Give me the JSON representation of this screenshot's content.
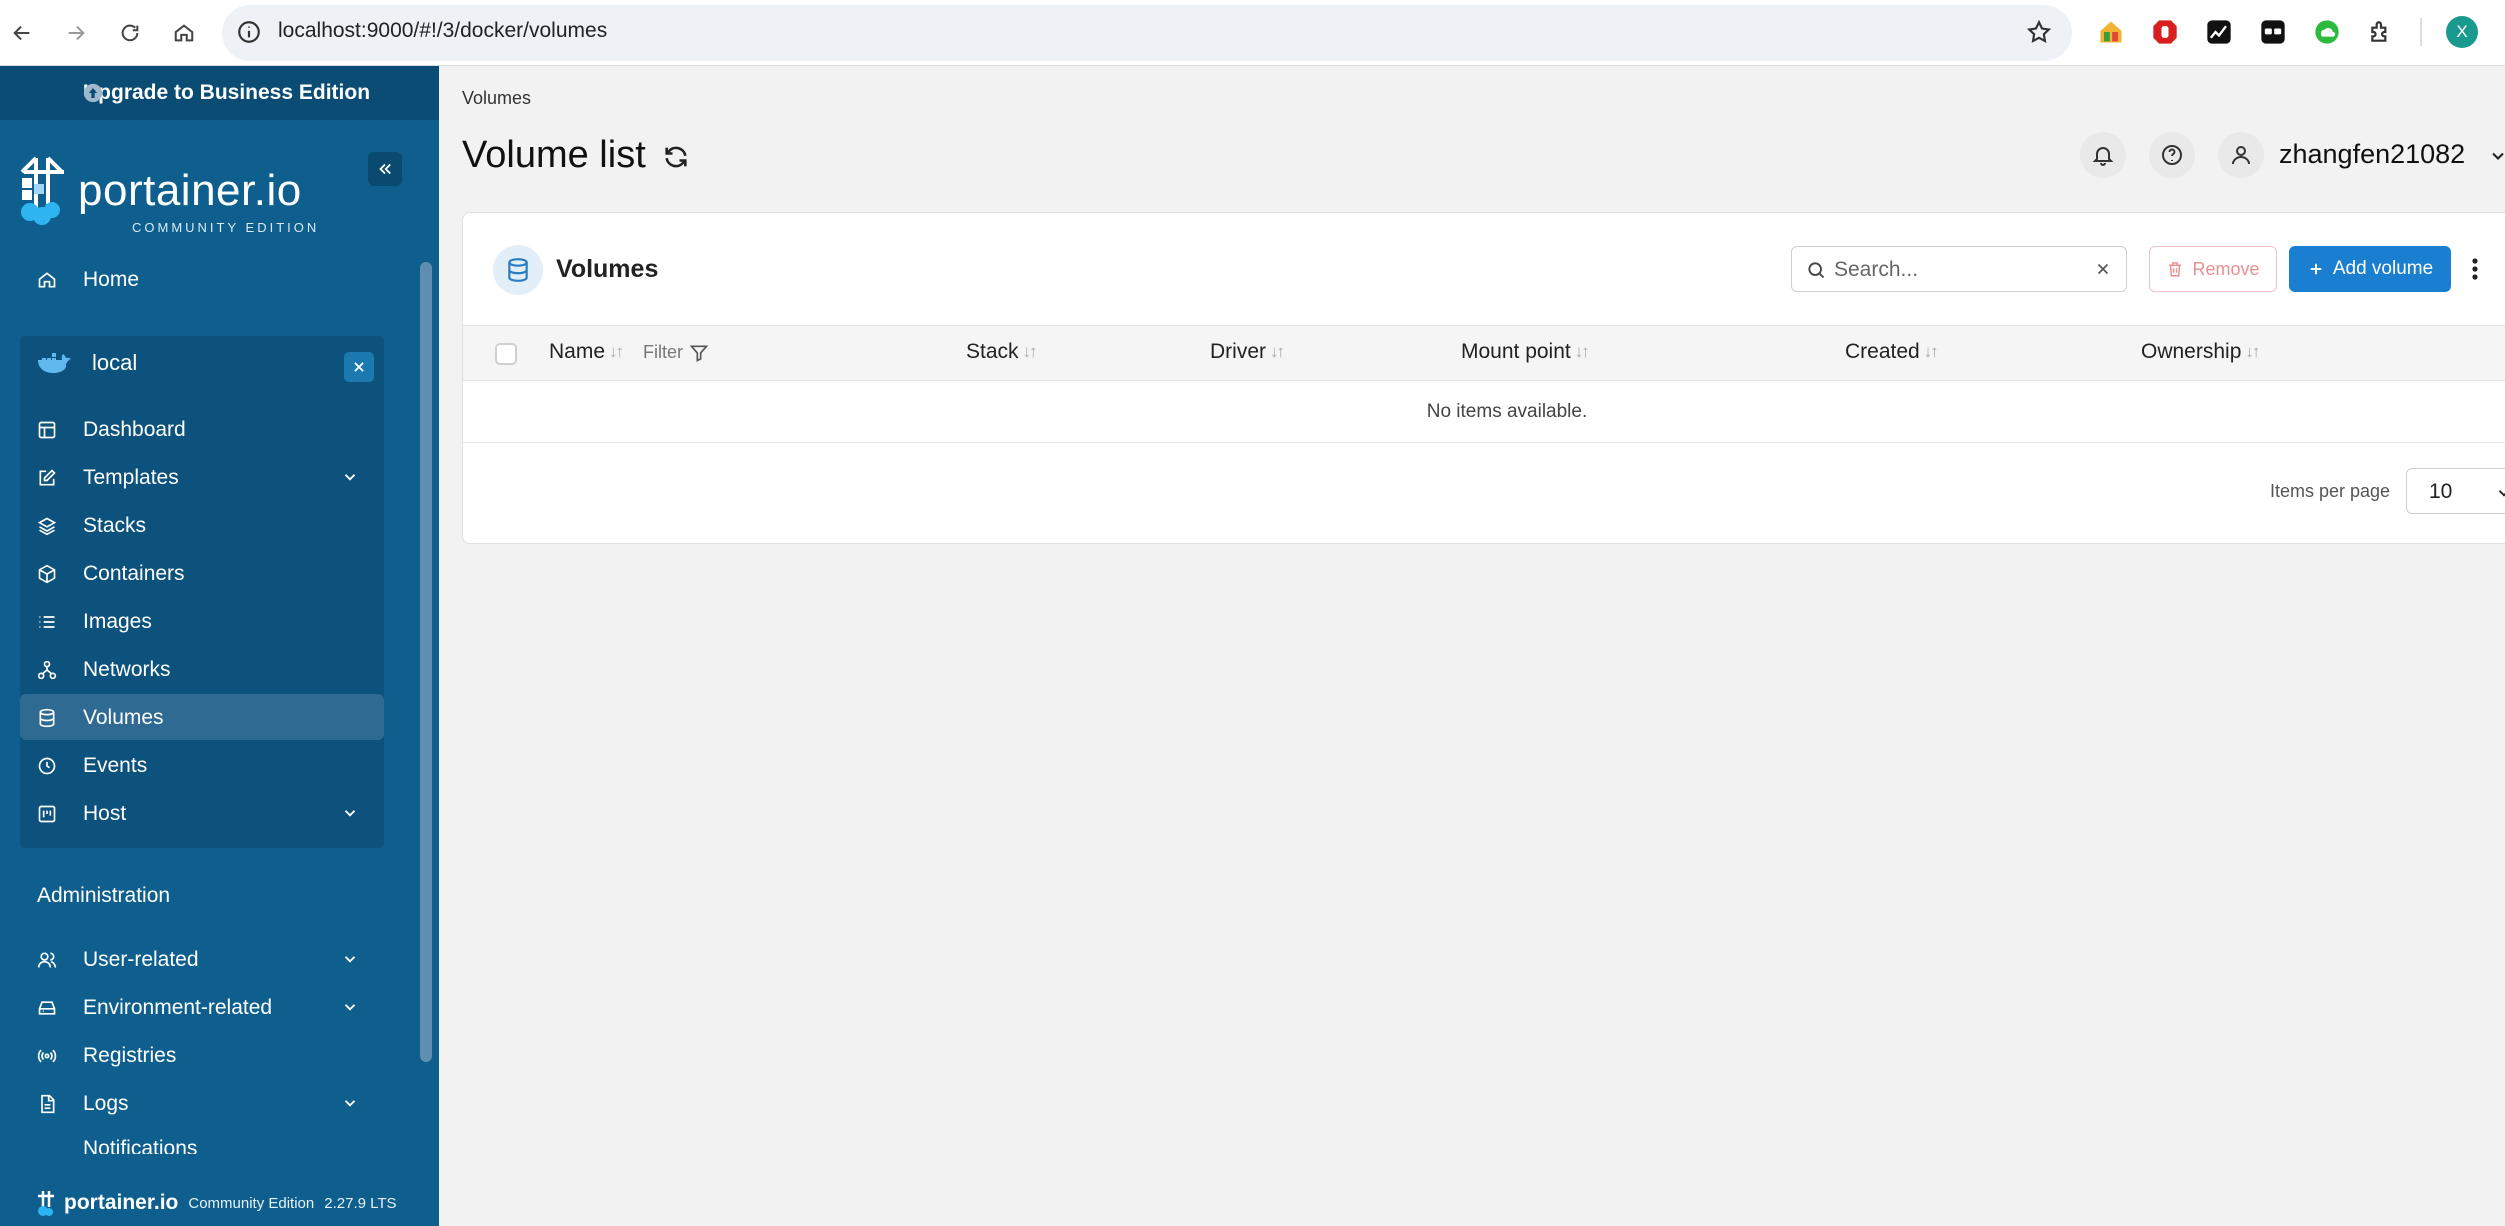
{
  "browser": {
    "url": "localhost:9000/#!/3/docker/volumes",
    "profile_initial": "X"
  },
  "sidebar": {
    "upgrade_label": "Upgrade to Business Edition",
    "brand_name": "portainer.io",
    "brand_sub": "COMMUNITY EDITION",
    "home": "Home",
    "environment": "local",
    "env_items": {
      "dashboard": "Dashboard",
      "templates": "Templates",
      "stacks": "Stacks",
      "containers": "Containers",
      "images": "Images",
      "networks": "Networks",
      "volumes": "Volumes",
      "events": "Events",
      "host": "Host"
    },
    "admin_title": "Administration",
    "admin_items": {
      "user_related": "User-related",
      "environment_related": "Environment-related",
      "registries": "Registries",
      "logs": "Logs",
      "notifications": "Notifications"
    },
    "footer_brand": "portainer.io",
    "footer_edition": "Community Edition",
    "footer_version": "2.27.9 LTS"
  },
  "header": {
    "breadcrumb": "Volumes",
    "title": "Volume list",
    "username": "zhangfen21082"
  },
  "table": {
    "title": "Volumes",
    "search_placeholder": "Search...",
    "remove_label": "Remove",
    "add_label": "Add volume",
    "columns": {
      "name": "Name",
      "filter": "Filter",
      "stack": "Stack",
      "driver": "Driver",
      "mount_point": "Mount point",
      "created": "Created",
      "ownership": "Ownership"
    },
    "empty_message": "No items available.",
    "items_per_page_label": "Items per page",
    "items_per_page": "10"
  },
  "colors": {
    "sidebar_bg": "#0f5f8e",
    "sidebar_env_bg": "#0c527c",
    "sidebar_active": "#2f6a92",
    "primary": "#1a7fd1",
    "danger": "#e89090"
  }
}
